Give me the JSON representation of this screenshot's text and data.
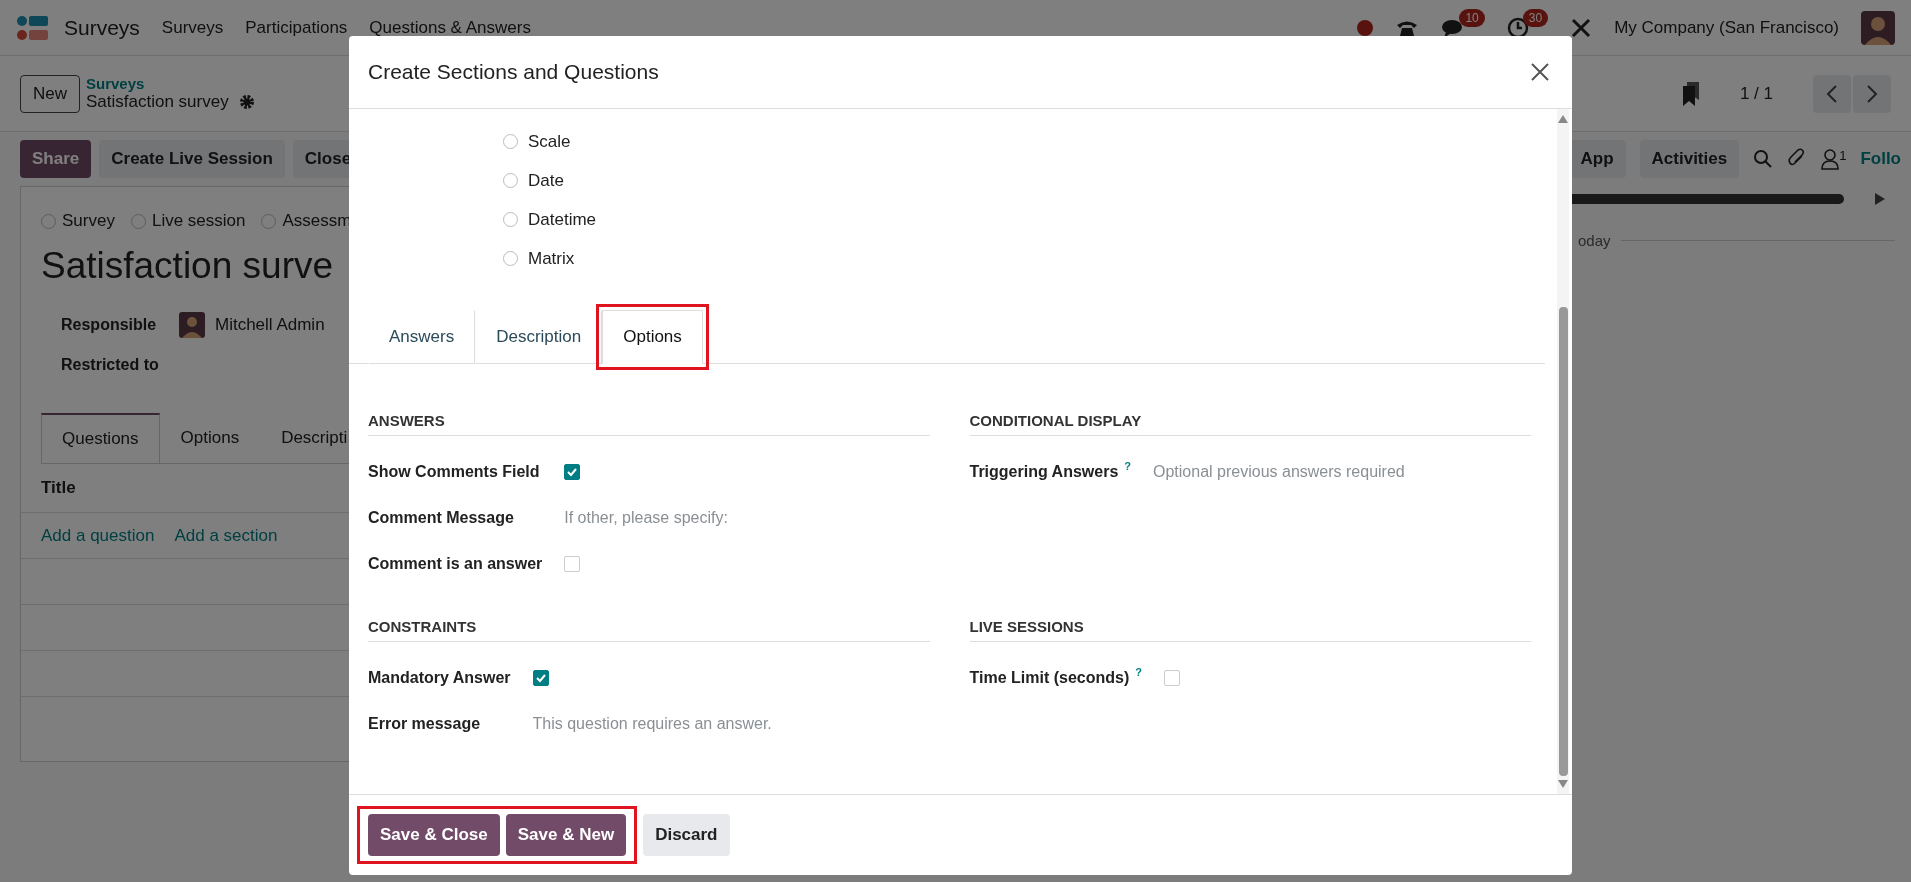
{
  "navbar": {
    "app_name": "Surveys",
    "menu": [
      "Surveys",
      "Participations",
      "Questions & Answers"
    ],
    "message_count": "10",
    "activity_count": "30",
    "company": "My Company (San Francisco)"
  },
  "breadcrumb": {
    "new_button": "New",
    "parent": "Surveys",
    "current": "Satisfaction survey"
  },
  "pager": {
    "value": "1 / 1"
  },
  "actions": [
    {
      "label": "Share",
      "kind": "primary"
    },
    {
      "label": "Create Live Session",
      "kind": "secondary"
    },
    {
      "label": "Close",
      "kind": "secondary"
    }
  ],
  "chatter": {
    "buttons": [
      "App",
      "Activities"
    ],
    "follower_count": "1",
    "follow_label": "Follo",
    "date_separator": "oday"
  },
  "form": {
    "survey_types": [
      {
        "label": "Survey",
        "selected": false
      },
      {
        "label": "Live session",
        "selected": false
      },
      {
        "label": "Assessm",
        "selected": false
      }
    ],
    "title": "Satisfaction surve",
    "fields": [
      {
        "label": "Responsible",
        "kind": "user",
        "value": "Mitchell Admin"
      },
      {
        "label": "Restricted to",
        "kind": "text"
      }
    ],
    "tabs": [
      {
        "label": "Questions",
        "selected": true
      },
      {
        "label": "Options",
        "selected": false
      },
      {
        "label": "Descripti",
        "selected": false
      }
    ],
    "columns": [
      "Title"
    ],
    "add_links": [
      "Add a question",
      "Add a section"
    ]
  },
  "dialog": {
    "title": "Create Sections and Questions",
    "question_types": [
      {
        "label": "Scale",
        "selected": false
      },
      {
        "label": "Date",
        "selected": false
      },
      {
        "label": "Datetime",
        "selected": false
      },
      {
        "label": "Matrix",
        "selected": false
      }
    ],
    "tabs": [
      {
        "label": "Answers",
        "selected": false,
        "highlighted": false
      },
      {
        "label": "Description",
        "selected": false,
        "highlighted": false
      },
      {
        "label": "Options",
        "selected": true,
        "highlighted": true
      }
    ],
    "sections": [
      {
        "title": "ANSWERS",
        "fields": [
          {
            "label": "Show Comments Field",
            "kind": "checkbox",
            "checked": true
          },
          {
            "label": "Comment Message",
            "kind": "text",
            "placeholder": "If other, please specify:"
          },
          {
            "label": "Comment is an answer",
            "kind": "checkbox",
            "checked": false
          }
        ]
      },
      {
        "title": "CONDITIONAL DISPLAY",
        "fields": [
          {
            "label": "Triggering Answers",
            "help": "?",
            "kind": "text",
            "placeholder": "Optional previous answers required"
          }
        ]
      },
      {
        "title": "CONSTRAINTS",
        "fields": [
          {
            "label": "Mandatory Answer",
            "kind": "checkbox",
            "checked": true
          },
          {
            "label": "Error message",
            "kind": "text",
            "placeholder": "This question requires an answer."
          }
        ]
      },
      {
        "title": "LIVE SESSIONS",
        "fields": [
          {
            "label": "Time Limit (seconds)",
            "help": "?",
            "kind": "checkbox",
            "checked": false
          }
        ]
      }
    ],
    "buttons": [
      {
        "label": "Save & Close",
        "kind": "primary"
      },
      {
        "label": "Save & New",
        "kind": "primary"
      },
      {
        "label": "Discard",
        "kind": "secondary"
      }
    ],
    "buttons_highlighted": true
  }
}
